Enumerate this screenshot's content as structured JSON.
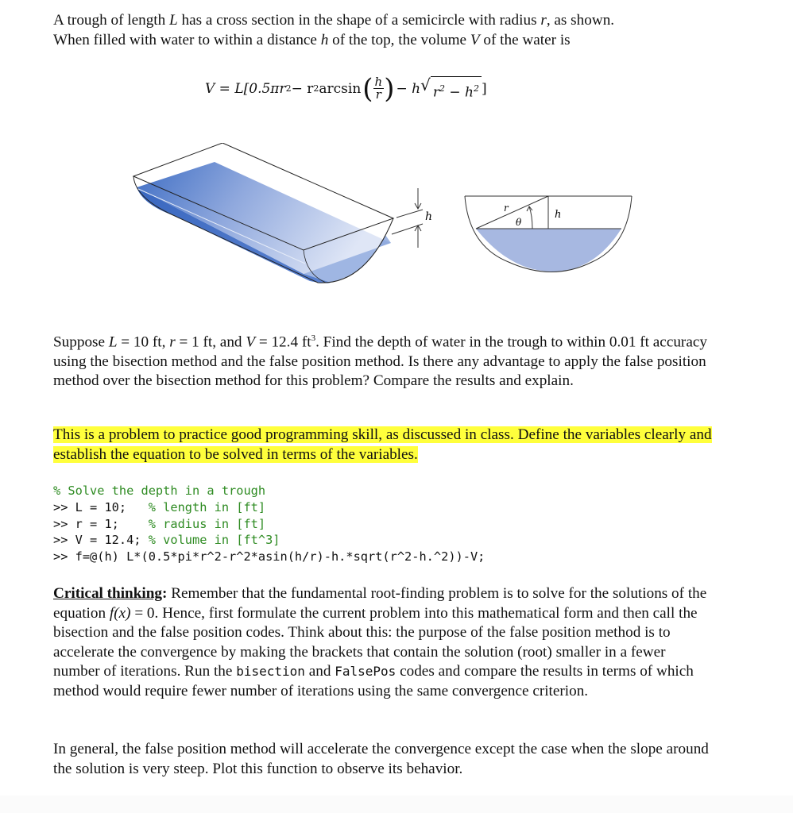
{
  "intro": {
    "line1_a": "A trough of length ",
    "var_L": "L",
    "line1_b": " has a cross section in the shape of a semicircle with radius ",
    "var_r": "r",
    "line1_c": ", as shown.",
    "line2_a": "When filled with water to within a distance ",
    "var_h": "h",
    "line2_b": " of the top, the volume ",
    "var_V": "V",
    "line2_c": " of the water is"
  },
  "equation": {
    "lhs": "V = L[0.5πr",
    "part2": " − r",
    "arcsin": " arcsin",
    "num": "h",
    "den": "r",
    "part3": " − h",
    "rad_a": "r",
    "rad_b": " − h",
    "close": "]",
    "sq": "2"
  },
  "diagram": {
    "label_h_3d": "h",
    "label_r": "r",
    "label_theta": "θ",
    "label_h": "h",
    "water_color": "#4a76c9",
    "cross_water_color": "#a7b8e1"
  },
  "problem": {
    "a": "Suppose ",
    "L": "L",
    "b": " = 10 ft, ",
    "r": "r",
    "c": " = 1 ft, and ",
    "V": "V",
    "d": " = 12.4 ft",
    "sup": "3",
    "e": ".  Find the depth of water in the trough to within 0.01 ft accuracy using the bisection method and the false position method.  Is there any advantage to apply the false position method over the bisection method for this problem? Compare the results and explain."
  },
  "note": {
    "text": "This is a problem to practice good programming skill, as discussed in class.  Define the variables clearly and establish the equation to be solved in terms of the variables.",
    "highlight_color": "#ffff3c"
  },
  "code": {
    "lines": [
      {
        "code": "",
        "comment": "% Solve the depth in a trough"
      },
      {
        "code": ">> L = 10;   ",
        "comment": "% length in [ft]"
      },
      {
        "code": ">> r = 1;    ",
        "comment": "% radius in [ft]"
      },
      {
        "code": ">> V = 12.4; ",
        "comment": "% volume in [ft^3]"
      },
      {
        "code": ">> f=@(h) L*(0.5*pi*r^2-r^2*asin(h/r)-h.*sqrt(r^2-h.^2))-V;",
        "comment": ""
      }
    ],
    "comment_color": "#2e8b22"
  },
  "critical": {
    "label": "Critical thinking",
    "colon": ":",
    "a": " Remember that the fundamental root-finding problem is to solve for the solutions of the equation ",
    "fx": "f(x)",
    "b": " = 0.  Hence, first formulate the current problem into this mathematical form and then call the bisection and the false position codes.  Think about this: the purpose of the false position method is to accelerate the convergence by making the brackets that contain the solution (root) smaller in a fewer number of iterations.  Run the ",
    "bisection": "bisection",
    "c": " and ",
    "falsepos": "FalsePos",
    "d": " codes and compare the results in terms of which method would require fewer number of iterations using the same convergence criterion."
  },
  "closing": {
    "text": "In general, the false position method will accelerate the convergence except the case when the slope around the solution is very steep.  Plot this function to observe its behavior."
  }
}
